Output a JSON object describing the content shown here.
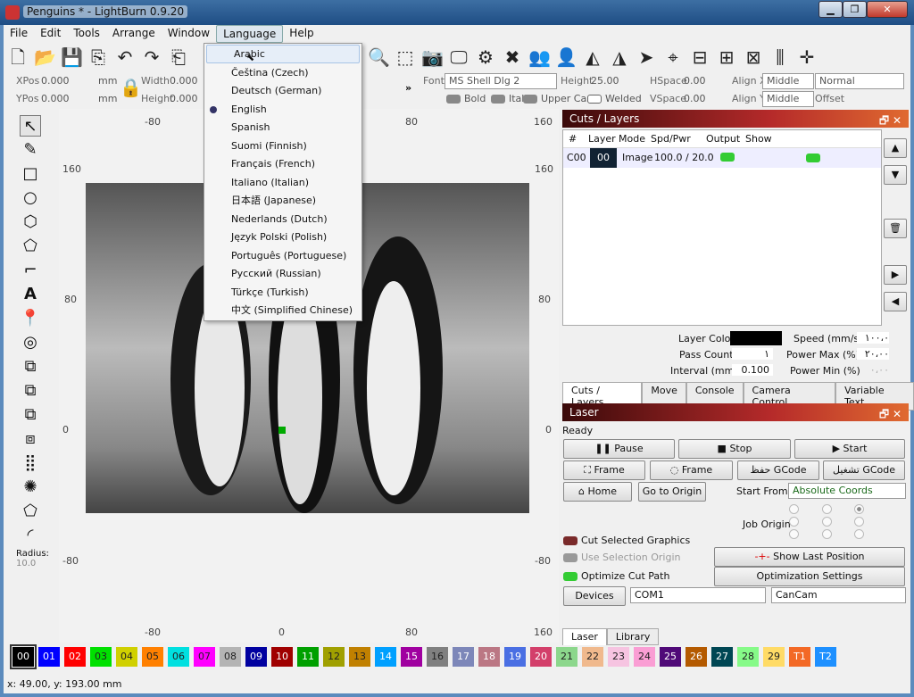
{
  "window": {
    "title": "Penguins * - LightBurn 0.9.20",
    "min": "▁",
    "max": "❐",
    "close": "✕"
  },
  "menubar": [
    "File",
    "Edit",
    "Tools",
    "Arrange",
    "Window",
    "Language",
    "Help"
  ],
  "language_menu": {
    "items": [
      "Arabic",
      "Čeština (Czech)",
      "Deutsch (German)",
      "English",
      "Spanish",
      "Suomi (Finnish)",
      "Français (French)",
      "Italiano (Italian)",
      "日本語 (Japanese)",
      "Nederlands (Dutch)",
      "Język Polski (Polish)",
      "Português (Portuguese)",
      "Русский (Russian)",
      "Türkçe (Turkish)",
      "中文 (Simplified Chinese)"
    ],
    "hovered": "Arabic",
    "checked": "English"
  },
  "props": {
    "xpos_label": "XPos",
    "xpos": "0.000",
    "ypos_label": "YPos",
    "ypos": "0.000",
    "unit": "mm",
    "width_label": "Width",
    "width": "0.000",
    "height_label": "Height",
    "height": "0.000",
    "more": "»"
  },
  "text_props": {
    "font_label": "Font",
    "font": "MS Shell Dlg 2",
    "height_label": "Height",
    "height": "25.00",
    "hspace_label": "HSpace",
    "hspace": "0.00",
    "vspace_label": "VSpace",
    "vspace": "0.00",
    "alignx_label": "Align X",
    "alignx": "Middle",
    "aligny_label": "Align Y",
    "aligny": "Middle",
    "style": "Normal",
    "offset_label": "Offset",
    "bold": "Bold",
    "italic": "Italic",
    "upper": "Upper Case",
    "welded": "Welded"
  },
  "rulers": {
    "top": [
      "-80",
      "0",
      "80",
      "160"
    ],
    "left": [
      "160",
      "80",
      "0",
      "-80"
    ],
    "right": [
      "160",
      "80",
      "0",
      "-80"
    ],
    "bottom": [
      "-80",
      "0",
      "80",
      "160"
    ]
  },
  "left_tools": {
    "radius_label": "Radius:",
    "radius": "10.0"
  },
  "cuts": {
    "title": "Cuts / Layers",
    "headers": [
      "#",
      "Layer",
      "Mode",
      "Spd/Pwr",
      "Output",
      "Show"
    ],
    "rows": [
      {
        "num": "C00",
        "layer": "00",
        "mode": "Image",
        "spdpwr": "100.0 / 20.0"
      }
    ],
    "layer_color_label": "Layer Color",
    "layer_color": "#000000",
    "pass_label": "Pass Count",
    "pass": "١",
    "interval_label": "Interval (mm)",
    "interval": "0.100",
    "speed_label": "Speed (mm/s)",
    "speed": "١٠٠،٠",
    "pmax_label": "Power Max (%)",
    "pmax": "٢٠،٠٠",
    "pmin_label": "Power Min (%)",
    "pmin": "٠،٠٠",
    "tabs": [
      "Cuts / Layers",
      "Move",
      "Console",
      "Camera Control",
      "Variable Text"
    ]
  },
  "laser": {
    "title": "Laser",
    "status": "Ready",
    "pause": "Pause",
    "stop": "Stop",
    "start": "Start",
    "frame1": "Frame",
    "frame2": "Frame",
    "save_gcode": "حفظ GCode",
    "run_gcode": "تشغيل GCode",
    "home": "Home",
    "go_origin": "Go to Origin",
    "start_from_label": "Start From:",
    "start_from": "Absolute Coords",
    "job_origin_label": "Job Origin",
    "cut_selected": "Cut Selected Graphics",
    "use_sel_origin": "Use Selection Origin",
    "optimize": "Optimize Cut Path",
    "show_last": "Show Last Position",
    "opt_settings": "Optimization Settings",
    "devices": "Devices",
    "port": "COM1",
    "device": "CanCam",
    "tabs": [
      "Laser",
      "Library"
    ]
  },
  "palette": [
    {
      "l": "00",
      "c": "#000000"
    },
    {
      "l": "01",
      "c": "#0000ff"
    },
    {
      "l": "02",
      "c": "#ff0000"
    },
    {
      "l": "03",
      "c": "#00e000"
    },
    {
      "l": "04",
      "c": "#d0d000"
    },
    {
      "l": "05",
      "c": "#ff8000"
    },
    {
      "l": "06",
      "c": "#00e0e0"
    },
    {
      "l": "07",
      "c": "#ff00ff"
    },
    {
      "l": "08",
      "c": "#b4b4b4"
    },
    {
      "l": "09",
      "c": "#0000a0"
    },
    {
      "l": "10",
      "c": "#a00000"
    },
    {
      "l": "11",
      "c": "#00a000"
    },
    {
      "l": "12",
      "c": "#a0a000"
    },
    {
      "l": "13",
      "c": "#c08000"
    },
    {
      "l": "14",
      "c": "#00a0ff"
    },
    {
      "l": "15",
      "c": "#a000a0"
    },
    {
      "l": "16",
      "c": "#808080"
    },
    {
      "l": "17",
      "c": "#7d87b9"
    },
    {
      "l": "18",
      "c": "#bb7784"
    },
    {
      "l": "19",
      "c": "#4a6fe3"
    },
    {
      "l": "20",
      "c": "#d33f6a"
    },
    {
      "l": "21",
      "c": "#8cd78c"
    },
    {
      "l": "22",
      "c": "#f0b98d"
    },
    {
      "l": "23",
      "c": "#f6c4e1"
    },
    {
      "l": "24",
      "c": "#fa9ed4"
    },
    {
      "l": "25",
      "c": "#500a78"
    },
    {
      "l": "26",
      "c": "#b45a00"
    },
    {
      "l": "27",
      "c": "#004754"
    },
    {
      "l": "28",
      "c": "#86fa88"
    },
    {
      "l": "29",
      "c": "#ffdb66"
    },
    {
      "l": "T1",
      "c": "#f36926"
    },
    {
      "l": "T2",
      "c": "#1e90ff"
    }
  ],
  "status": "x: 49.00, y: 193.00 mm"
}
